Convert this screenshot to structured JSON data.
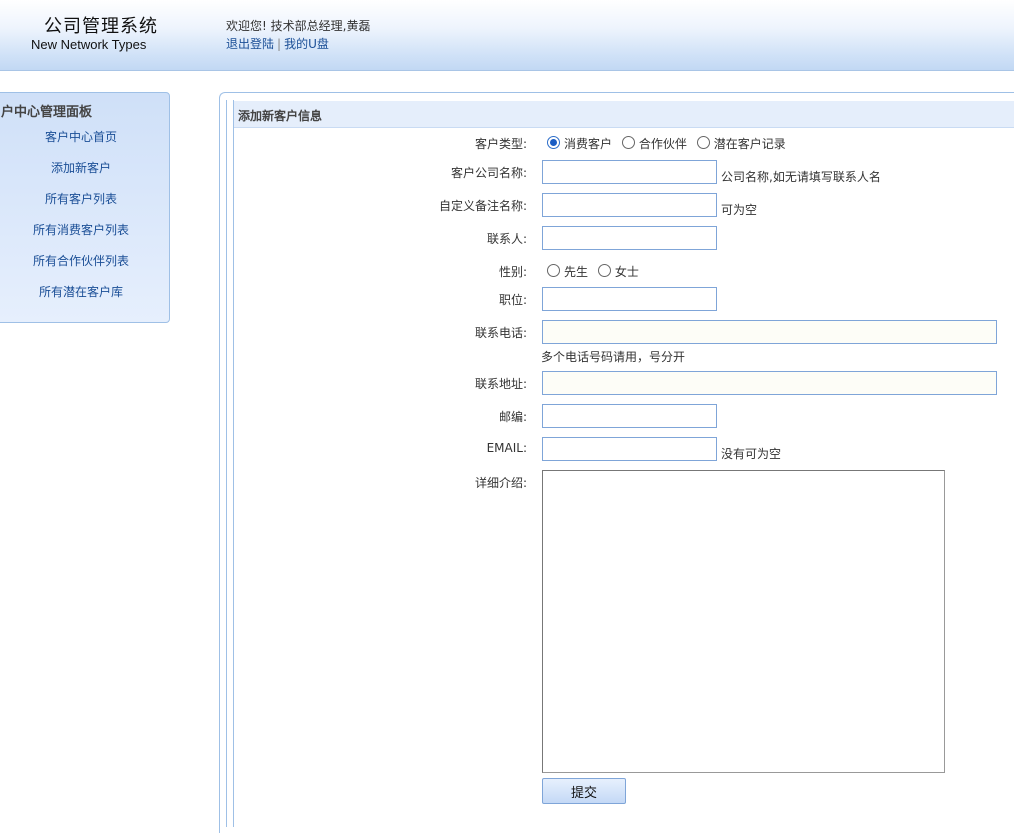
{
  "header": {
    "title": "公司管理系统",
    "subtitle": "New Network Types",
    "welcome": "欢迎您! 技术部总经理,黄磊",
    "links": {
      "logout": "退出登陆",
      "separator": "|",
      "my_disk": "我的U盘"
    }
  },
  "sidebar": {
    "title": "户中心管理面板",
    "items": [
      {
        "label": "客户中心首页"
      },
      {
        "label": "添加新客户"
      },
      {
        "label": "所有客户列表"
      },
      {
        "label": "所有消费客户列表"
      },
      {
        "label": "所有合作伙伴列表"
      },
      {
        "label": "所有潜在客户库"
      }
    ]
  },
  "panel": {
    "title": "添加新客户信息"
  },
  "form": {
    "customer_type": {
      "label": "客户类型:",
      "options": [
        "消费客户",
        "合作伙伴",
        "潜在客户记录"
      ],
      "selected": "消费客户"
    },
    "company_name": {
      "label": "客户公司名称:",
      "value": "",
      "hint": "公司名称,如无请填写联系人名"
    },
    "alias": {
      "label": "自定义备注名称:",
      "value": "",
      "hint": "可为空"
    },
    "contact": {
      "label": "联系人:",
      "value": ""
    },
    "gender": {
      "label": "性别:",
      "options": [
        "先生",
        "女士"
      ],
      "selected": ""
    },
    "position": {
      "label": "职位:",
      "value": ""
    },
    "phone": {
      "label": "联系电话:",
      "value": "",
      "hint": "多个电话号码请用，号分开"
    },
    "address": {
      "label": "联系地址:",
      "value": ""
    },
    "zip": {
      "label": "邮编:",
      "value": ""
    },
    "email": {
      "label": "EMAIL:",
      "value": "",
      "hint": "没有可为空"
    },
    "detail": {
      "label": "详细介绍:",
      "value": ""
    },
    "submit_label": "提交"
  },
  "colors": {
    "accent_link": "#1a4e96",
    "panel_border": "#9fc0e6",
    "header_gradient_end": "#c2d8f4",
    "input_border": "#7fa5d8"
  }
}
